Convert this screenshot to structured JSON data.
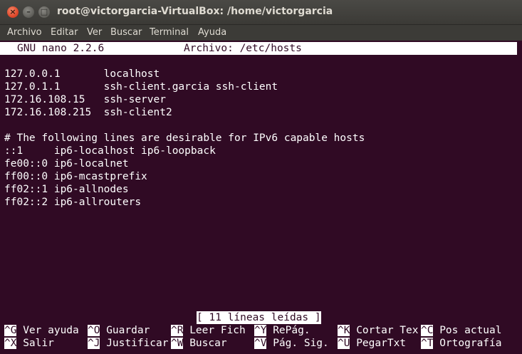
{
  "window": {
    "title": "root@victorgarcia-VirtualBox: /home/victorgarcia",
    "close_glyph": "×",
    "min_glyph": "–",
    "max_glyph": "□"
  },
  "menu": [
    "Archivo",
    "Editar",
    "Ver",
    "Buscar",
    "Terminal",
    "Ayuda"
  ],
  "nano": {
    "version": "GNU nano 2.2.6",
    "file_label": "Archivo: /etc/hosts",
    "status": "[ 11 líneas leídas ]"
  },
  "hosts_lines": [
    "127.0.0.1       localhost",
    "127.0.1.1       ssh-client.garcia ssh-client",
    "172.16.108.15   ssh-server",
    "172.16.108.215  ssh-client2",
    "",
    "# The following lines are desirable for IPv6 capable hosts",
    "::1     ip6-localhost ip6-loopback",
    "fe00::0 ip6-localnet",
    "ff00::0 ip6-mcastprefix",
    "ff02::1 ip6-allnodes",
    "ff02::2 ip6-allrouters"
  ],
  "shortcuts": {
    "row1": [
      {
        "key": "^G",
        "label": "Ver ayuda"
      },
      {
        "key": "^O",
        "label": "Guardar"
      },
      {
        "key": "^R",
        "label": "Leer Fich"
      },
      {
        "key": "^Y",
        "label": "RePág."
      },
      {
        "key": "^K",
        "label": "Cortar Tex"
      },
      {
        "key": "^C",
        "label": "Pos actual"
      }
    ],
    "row2": [
      {
        "key": "^X",
        "label": "Salir"
      },
      {
        "key": "^J",
        "label": "Justificar"
      },
      {
        "key": "^W",
        "label": "Buscar"
      },
      {
        "key": "^V",
        "label": "Pág. Sig."
      },
      {
        "key": "^U",
        "label": "PegarTxt"
      },
      {
        "key": "^T",
        "label": "Ortografía"
      }
    ]
  },
  "colors": {
    "terminal_bg": "#300a24",
    "terminal_fg": "#ffffff",
    "titlebar": "#3b3a36",
    "close_button": "#e0482b"
  }
}
